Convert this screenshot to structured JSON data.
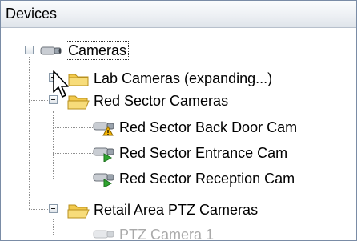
{
  "panel": {
    "title": "Devices"
  },
  "tree": {
    "root": {
      "label": "Cameras",
      "expanded": true,
      "selected": true
    },
    "groups": [
      {
        "label": "Lab Cameras (expanding...)",
        "expanded": false,
        "children": []
      },
      {
        "label": "Red Sector Cameras",
        "expanded": true,
        "children": [
          {
            "label": "Red Sector Back Door Cam",
            "status": "warning"
          },
          {
            "label": "Red Sector Entrance Cam",
            "status": "ok"
          },
          {
            "label": "Red Sector Reception Cam",
            "status": "ok"
          }
        ]
      },
      {
        "label": "Retail Area PTZ Cameras",
        "expanded": true,
        "children": [
          {
            "label": "PTZ Camera 1",
            "status": "disabled"
          }
        ]
      }
    ]
  },
  "colors": {
    "folder": "#f2c94c",
    "status_ok": "#2fa52f",
    "status_warning": "#f3b200",
    "disabled_text": "#a9a9a9"
  },
  "icons": {
    "camera": "camera-icon",
    "folder": "folder-icon",
    "warning": "warning-icon",
    "play": "play-icon",
    "cursor": "mouse-pointer-icon"
  }
}
